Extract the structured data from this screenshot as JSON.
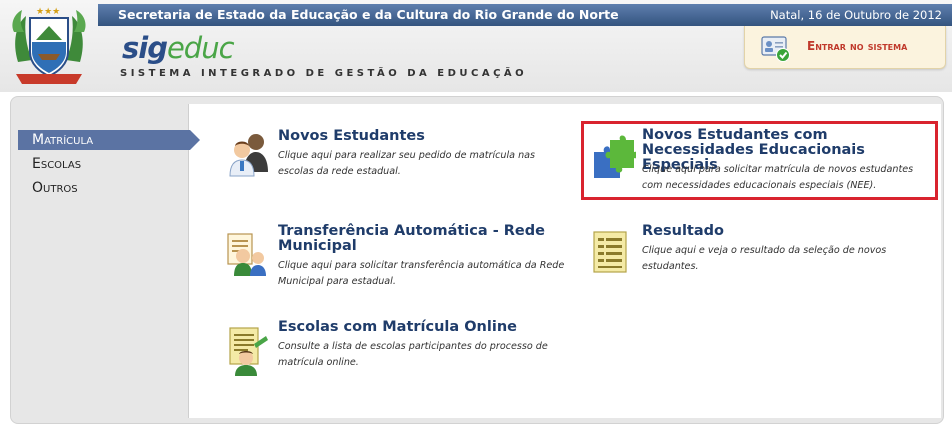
{
  "header": {
    "title": "Secretaria de Estado da Educação e da Cultura do Rio Grande do Norte",
    "date": "Natal, 16 de Outubro de 2012",
    "logo_sig": "sig",
    "logo_educ": "educ",
    "logo_subtitle": "SISTEMA INTEGRADO DE GESTÃO DA EDUCAÇÃO",
    "login_label": "Entrar no sistema"
  },
  "nav": {
    "items": [
      {
        "label": "Matrícula",
        "active": true
      },
      {
        "label": "Escolas",
        "active": false
      },
      {
        "label": "Outros",
        "active": false
      }
    ]
  },
  "options": {
    "novos_estudantes": {
      "title": "Novos Estudantes",
      "desc": "Clique aqui para realizar seu pedido de matrícula nas escolas da rede estadual.",
      "icon": "students-icon"
    },
    "nee": {
      "title": "Novos Estudantes com Necessidades Educacionais Especiais",
      "desc": "Clique aqui para solicitar matrícula de novos estudantes com necessidades educacionais especiais (NEE).",
      "icon": "puzzle-icon"
    },
    "transferencia": {
      "title": "Transferência Automática - Rede Municipal",
      "desc": "Clique aqui para solicitar transferência automática da Rede Municipal para estadual.",
      "icon": "transfer-icon"
    },
    "resultado": {
      "title": "Resultado",
      "desc": "Clique aqui e veja o resultado da seleção de novos estudantes.",
      "icon": "document-icon"
    },
    "escolas_online": {
      "title": "Escolas com Matrícula Online",
      "desc": "Consulte a lista de escolas participantes do processo de matrícula online.",
      "icon": "list-icon"
    }
  },
  "colors": {
    "topbar": "#34547f",
    "nav_active": "#5b73a3",
    "title_text": "#1f3c6a",
    "highlight": "#d9232e",
    "login_text": "#c0392b"
  }
}
